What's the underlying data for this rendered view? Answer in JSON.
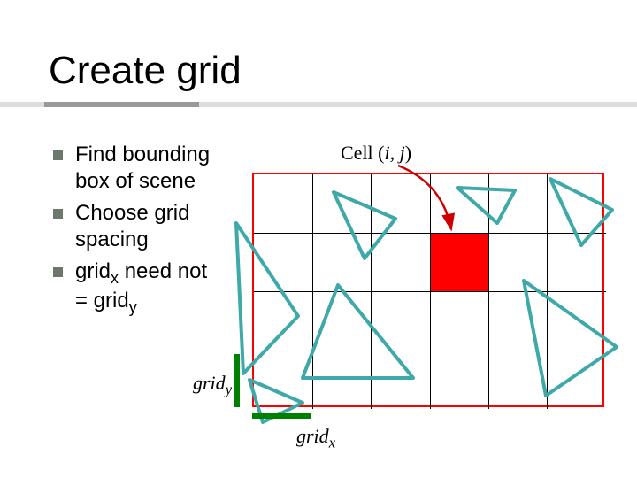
{
  "title": "Create grid",
  "bullets": [
    "Find bounding box of scene",
    "Choose grid spacing",
    "grid<sub>x</sub> need not = grid<sub>y</sub>"
  ],
  "bullet1": "Find bounding box of scene",
  "bullet2": "Choose grid spacing",
  "bullet3_a": "grid",
  "bullet3_b": "x",
  "bullet3_c": " need not = grid",
  "bullet3_d": "y",
  "cell_label_prefix": "Cell (",
  "cell_label_i": "i",
  "cell_label_sep": ", ",
  "cell_label_j": "j",
  "cell_label_suffix": ")",
  "gridy_a": "grid",
  "gridy_b": "y",
  "gridx_a": "grid",
  "gridx_b": "x",
  "grid": {
    "cols": 6,
    "rows": 4,
    "highlight": {
      "col": 3,
      "row": 1
    }
  }
}
